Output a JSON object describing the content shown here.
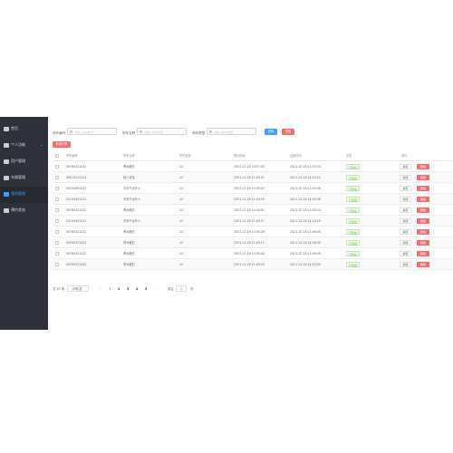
{
  "sidebar": {
    "items": [
      {
        "label": "首页",
        "icon": "home-icon",
        "active": false
      },
      {
        "label": "个人功能",
        "icon": "mail-icon",
        "active": false,
        "has_submenu": true
      },
      {
        "label": "用户管理",
        "icon": "user-icon",
        "active": false
      },
      {
        "label": "车辆管理",
        "icon": "car-icon",
        "active": false
      },
      {
        "label": "我的管理",
        "icon": "list-icon",
        "active": true
      },
      {
        "label": "预约状态",
        "icon": "grid-icon",
        "active": false
      }
    ]
  },
  "filters": [
    {
      "label": "停车编号",
      "placeholder": "请输入停车编号"
    },
    {
      "label": "停车名称",
      "placeholder": "请输入停车名称"
    },
    {
      "label": "停车类型",
      "placeholder": "请输入停车类型"
    }
  ],
  "buttons": {
    "search": "查询",
    "reset": "重置",
    "add": "新增记录"
  },
  "table": {
    "columns": [
      "停车编号",
      "停车名称",
      "停车数量",
      "预约时间",
      "结束时间",
      "状态",
      "操作"
    ],
    "status_label": "已完成",
    "edit_label": "编辑",
    "delete_label": "删除",
    "rows": [
      {
        "code": "00390321222",
        "name": "黄冰峰石",
        "qty": "13",
        "start": "2021-12-18 10:57:50",
        "end": "2021-12-18 11:03:34"
      },
      {
        "code": "06512212122",
        "name": "找人讲话",
        "qty": "13",
        "start": "2021-12-18 11:05:21",
        "end": "2021-12-18 11:22:51"
      },
      {
        "code": "04154491211",
        "name": "今天干点什么",
        "qty": "13",
        "start": "2021-12-18 11:05:21",
        "end": "2021-12-18 11:04:36"
      },
      {
        "code": "04154491211",
        "name": "今天干点什么",
        "qty": "13",
        "start": "2021-12-18 11:04:50",
        "end": "2021-12-18 11:05:36"
      },
      {
        "code": "00390321222",
        "name": "黄冰峰石",
        "qty": "13",
        "start": "2021-12-18 11:04:51",
        "end": "2021-12-18 11:05:24"
      },
      {
        "code": "04154491211",
        "name": "今天干点什么",
        "qty": "13",
        "start": "2021-12-18 11:05:27",
        "end": "2021-12-18 11:10:19"
      },
      {
        "code": "00390321222",
        "name": "黄冰峰石",
        "qty": "13",
        "start": "2021-12-18 11:05:29",
        "end": "2021-12-18 11:06:05"
      },
      {
        "code": "00390321222",
        "name": "黄冰峰石",
        "qty": "13",
        "start": "2021-12-18 11:05:11",
        "end": "2021-12-18 11:06:30"
      },
      {
        "code": "00390321222",
        "name": "黄冰峰石",
        "qty": "13",
        "start": "2021-12-18 11:05:42",
        "end": "2021-12-18 11:06:45"
      },
      {
        "code": "00390321222",
        "name": "黄冰峰石",
        "qty": "13",
        "start": "2021-12-18 11:05:53",
        "end": "2021-12-18 11:03:20"
      }
    ]
  },
  "pagination": {
    "total": "共 47 条",
    "page_size": "10条/页",
    "pages": [
      "1",
      "2",
      "3",
      "4",
      "5"
    ],
    "current_page": "1",
    "goto_label": "前往",
    "goto_value": "1",
    "goto_suffix": "页"
  },
  "colors": {
    "primary": "#409eff",
    "danger": "#f56c6c",
    "success": "#67c23a",
    "sidebar": "#2e3139"
  }
}
